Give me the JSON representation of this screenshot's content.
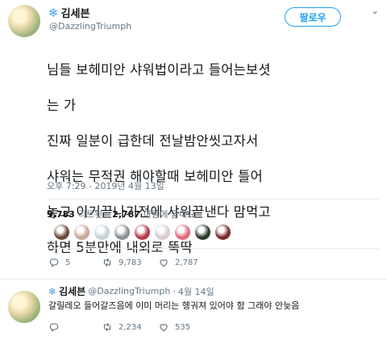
{
  "tweet": {
    "display_name": "김세븐",
    "handle": "@DazzlingTriumph",
    "follow_label": "팔로우",
    "lines": [
      "님들 보헤미안 샤워법이라고 들어는보셧",
      "는 가",
      "진짜 일분이 급한데 전날밤안씻고자서",
      "샤워는 무적권 해야할때 보헤미안 틀어",
      "놓고 이거끝나기전에 샤워끝낸다 맘먹고",
      "하면 5분만에 내외로 뚝딱"
    ],
    "timestamp": "오후 7:29 - 2019년 4월 13일",
    "retweets_count": "9,783",
    "retweets_label": "리트윗",
    "likes_count": "2,787",
    "likes_label": "마음에 들어요",
    "actions": {
      "replies": "5",
      "retweets": "9,783",
      "likes": "2,787"
    },
    "likers": [
      "#6a4a3a",
      "#c9a59a",
      "#c6d3d8",
      "#8a8f96",
      "#b83a4b",
      "#d8c8cf",
      "#e06a78",
      "#2b3b2a",
      "#7a2b2b"
    ]
  },
  "reply": {
    "display_name": "김세븐",
    "handle": "@DazzlingTriumph",
    "date": "4월 14일",
    "text": "갈릴레오 들어갈즈음에 이미 머리는 헹궈져 있어야 함 그래야 안늦음",
    "actions": {
      "retweets": "2,234",
      "likes": "535"
    }
  },
  "colors": {
    "accent": "#1da1f2",
    "muted": "#657786"
  }
}
